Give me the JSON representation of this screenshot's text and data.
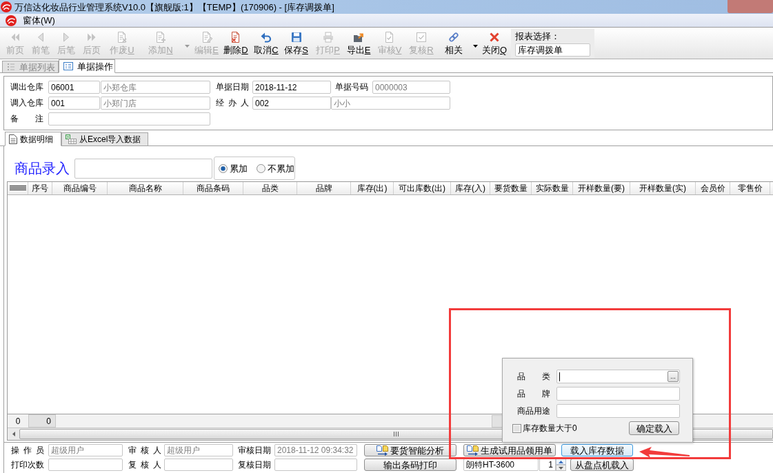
{
  "window": {
    "title": "万信达化妆品行业管理系统V10.0【旗舰版:1】【TEMP】(170906) - [库存调拨单]"
  },
  "menu": [
    {
      "label": "窗体(W)"
    }
  ],
  "toolbar": {
    "buttons": [
      {
        "kind": "first",
        "label": "前页",
        "disabled": true
      },
      {
        "kind": "prev",
        "label": "前笔",
        "disabled": true
      },
      {
        "kind": "next",
        "label": "后笔",
        "disabled": true
      },
      {
        "kind": "last",
        "label": "后页",
        "disabled": true
      },
      {
        "kind": "void",
        "label": "作废",
        "hotkey": "U",
        "disabled": true
      },
      {
        "kind": "add",
        "label": "添加",
        "hotkey": "N",
        "disabled": true
      },
      {
        "kind": "dropdown",
        "disabled": true
      },
      {
        "kind": "edit",
        "label": "编辑",
        "hotkey": "E",
        "disabled": true
      },
      {
        "kind": "delete",
        "label": "删除",
        "hotkey": "D",
        "disabled": false
      },
      {
        "kind": "cancel",
        "label": "取消",
        "hotkey": "C",
        "disabled": false
      },
      {
        "kind": "save",
        "label": "保存",
        "hotkey": "S",
        "disabled": false
      },
      {
        "kind": "print",
        "label": "打印",
        "hotkey": "P",
        "disabled": true
      },
      {
        "kind": "export",
        "label": "导出",
        "hotkey": "E",
        "disabled": false
      },
      {
        "kind": "audit",
        "label": "审核",
        "hotkey": "V",
        "disabled": true
      },
      {
        "kind": "recheck",
        "label": "复核",
        "hotkey": "R",
        "disabled": true
      },
      {
        "kind": "related",
        "label": "相关",
        "disabled": false
      },
      {
        "kind": "dropdown",
        "disabled": false
      },
      {
        "kind": "close",
        "label": "关闭",
        "hotkey": "Q",
        "disabled": false
      }
    ],
    "report_select": {
      "label": "报表选择：",
      "value": "库存调拨单"
    }
  },
  "tabs": [
    {
      "label": "单据列表",
      "selected": false
    },
    {
      "label": "单据操作",
      "selected": true
    }
  ],
  "header_form": {
    "rows": [
      [
        {
          "kind": "label",
          "text": "调出仓库"
        },
        {
          "kind": "input",
          "value": "06001",
          "readonly": false
        },
        {
          "kind": "input",
          "value": "小郑仓库",
          "readonly": true
        },
        {
          "kind": "label",
          "text": "单据日期"
        },
        {
          "kind": "input",
          "value": "2018-11-12",
          "readonly": false
        },
        {
          "kind": "label",
          "text": "单据号码"
        },
        {
          "kind": "input",
          "value": "0000003",
          "readonly": true
        }
      ],
      [
        {
          "kind": "label",
          "text": "调入仓库"
        },
        {
          "kind": "input",
          "value": "001",
          "readonly": false
        },
        {
          "kind": "input",
          "value": "小郑门店",
          "readonly": true
        },
        {
          "kind": "label",
          "text": "经 办 人"
        },
        {
          "kind": "input",
          "value": "002",
          "readonly": false
        },
        {
          "kind": "input",
          "value": "小小",
          "readonly": true
        }
      ],
      [
        {
          "kind": "label",
          "text": "备 注"
        },
        {
          "kind": "input"
        }
      ]
    ]
  },
  "detail_tabs": [
    {
      "kind": "document",
      "label": "数据明细",
      "selected": true
    },
    {
      "kind": "spreadsheet",
      "label": "从Excel导入数据",
      "selected": false
    }
  ],
  "entry": {
    "label": "商品录入",
    "options": [
      {
        "label": "累加",
        "selected": true
      },
      {
        "label": "不累加",
        "selected": false
      }
    ]
  },
  "table": {
    "columns": [
      "序号",
      "商品编号",
      "商品名称",
      "商品条码",
      "品类",
      "品牌",
      "库存(出)",
      "可出库数(出)",
      "库存(入)",
      "要货数量",
      "实际数量",
      "开样数量(要)",
      "开样数量(实)",
      "会员价",
      "零售价"
    ],
    "footer": [
      "0",
      "0"
    ]
  },
  "bottom_form": {
    "fields": [
      [
        {
          "kind": "label",
          "text": "操 作 员"
        },
        {
          "kind": "input",
          "value": "超级用户",
          "readonly": true
        },
        {
          "kind": "label",
          "text": "审 核 人"
        },
        {
          "kind": "input",
          "value": "超级用户",
          "readonly": true
        },
        {
          "kind": "label",
          "text": "审核日期"
        },
        {
          "kind": "input",
          "value": "2018-11-12 09:34:32",
          "readonly": true
        }
      ],
      [
        {
          "kind": "label",
          "text": "打印次数"
        },
        {
          "kind": "input"
        },
        {
          "kind": "label",
          "text": "复 核 人"
        },
        {
          "kind": "input"
        },
        {
          "kind": "label",
          "text": "复核日期"
        },
        {
          "kind": "input"
        }
      ]
    ],
    "buttons": [
      {
        "label": "要货智能分析",
        "icon": true,
        "focused": false
      },
      {
        "label": "生成试用品领用单",
        "icon": true,
        "focused": false
      },
      {
        "label": "载入库存数据",
        "icon": false,
        "focused": true
      }
    ],
    "barcode": {
      "button": "输出条码打印",
      "printer": "朗特HT-3600",
      "copies": "1",
      "load_button": "从盘点机载入"
    }
  },
  "dialog": {
    "fields": [
      {
        "label": "品 类",
        "focused": true,
        "button": "..."
      },
      {
        "label": "品 牌",
        "focused": false
      },
      {
        "label": "商品用途",
        "focused": false
      }
    ],
    "checkbox": {
      "label": "库存数量大于0",
      "checked": false
    },
    "confirm": "确定载入"
  }
}
